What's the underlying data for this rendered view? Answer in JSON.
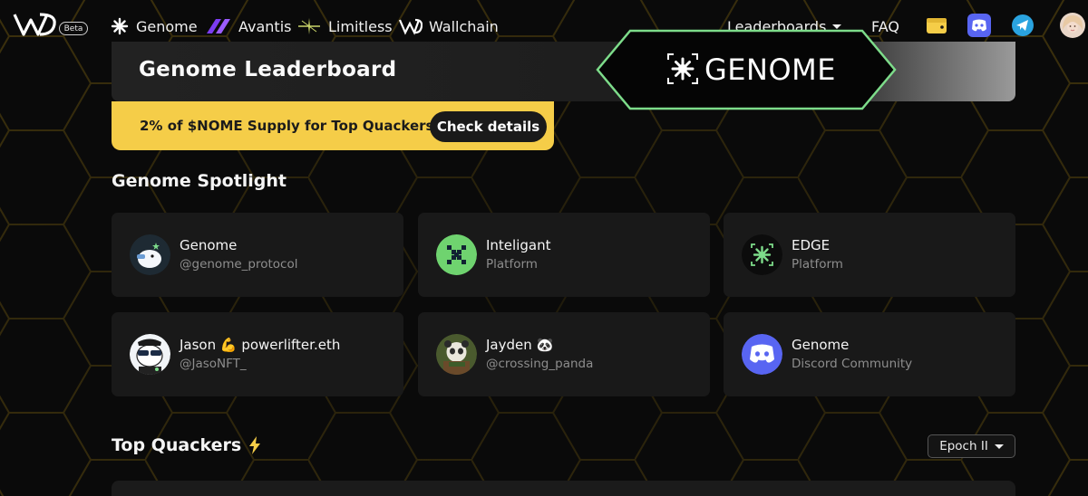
{
  "nav": {
    "beta_label": "Beta",
    "links": [
      {
        "label": "Genome",
        "icon": "genome-icon"
      },
      {
        "label": "Avantis",
        "icon": "avantis-icon"
      },
      {
        "label": "Limitless",
        "icon": "limitless-icon"
      },
      {
        "label": "Wallchain",
        "icon": "wallchain-icon"
      }
    ],
    "leaderboards_label": "Leaderboards",
    "faq_label": "FAQ",
    "icons": [
      "wallet-icon",
      "discord-icon",
      "telegram-icon",
      "avatar"
    ]
  },
  "header": {
    "title": "Genome Leaderboard",
    "badge_text": "GENOME"
  },
  "promo": {
    "text": "2% of $NOME Supply for Top Quackers!",
    "button_label": "Check details"
  },
  "spotlight": {
    "title": "Genome Spotlight",
    "cards": [
      {
        "name": "Genome",
        "sub": "@genome_protocol",
        "avatar": "genome-duck-avatar"
      },
      {
        "name": "Inteligant",
        "sub": "Platform",
        "avatar": "inteligant-avatar"
      },
      {
        "name": "EDGE",
        "sub": "Platform",
        "avatar": "edge-avatar"
      },
      {
        "name": "Jason 💪 powerlifter.eth",
        "sub": "@JasoNFT_",
        "avatar": "jason-avatar"
      },
      {
        "name": "Jayden 🐼",
        "sub": "@crossing_panda",
        "avatar": "panda-avatar"
      },
      {
        "name": "Genome",
        "sub": "Discord Community",
        "avatar": "discord-avatar"
      }
    ]
  },
  "top_quackers": {
    "title": "Top Quackers",
    "title_icon": "lightning-icon",
    "epoch_label": "Epoch II"
  },
  "colors": {
    "promo_yellow": "#f5cd48",
    "badge_green": "#7ddc8a",
    "discord_blue": "#5865f2",
    "telegram_blue": "#2aa3df",
    "hex_line": "#4a3d12"
  }
}
